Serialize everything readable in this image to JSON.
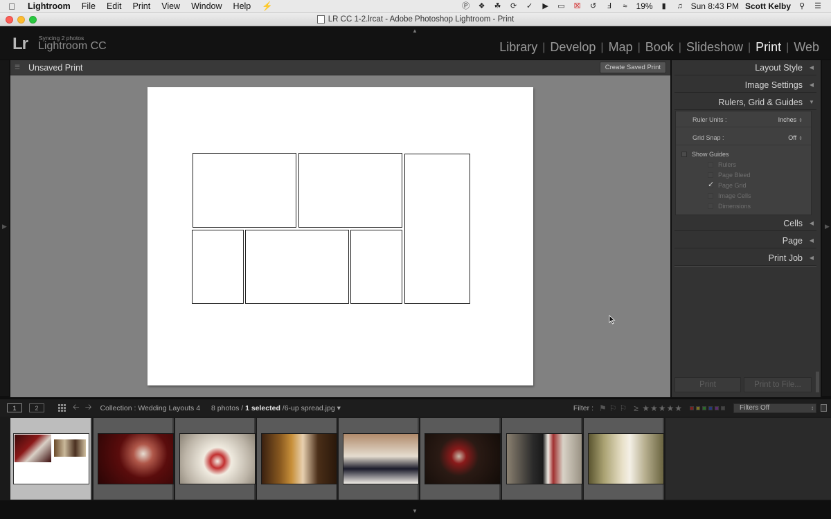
{
  "menubar": {
    "app_name": "Lightroom",
    "items": [
      "File",
      "Edit",
      "Print",
      "View",
      "Window",
      "Help"
    ],
    "battery": "19%",
    "clock": "Sun 8:43 PM",
    "user": "Scott Kelby"
  },
  "window": {
    "title": "LR CC 1-2.lrcat - Adobe Photoshop Lightroom - Print"
  },
  "identity": {
    "sync_status": "Syncing 2 photos",
    "product": "Lightroom CC",
    "logo": "Lr"
  },
  "modules": {
    "items": [
      "Library",
      "Develop",
      "Map",
      "Book",
      "Slideshow",
      "Print",
      "Web"
    ],
    "active": "Print"
  },
  "center": {
    "doc_title": "Unsaved Print",
    "save_button": "Create Saved Print"
  },
  "right_panel": {
    "layout_style": "Layout Style",
    "image_settings": "Image Settings",
    "rulers_grid_guides": "Rulers, Grid & Guides",
    "ruler_units_label": "Ruler Units :",
    "ruler_units_value": "Inches",
    "grid_snap_label": "Grid Snap :",
    "grid_snap_value": "Off",
    "show_guides": "Show Guides",
    "guides": [
      "Rulers",
      "Page Bleed",
      "Page Grid",
      "Image Cells",
      "Dimensions"
    ],
    "page_grid_checked": true,
    "cells": "Cells",
    "page": "Page",
    "print_job": "Print Job",
    "print_button": "Print",
    "print_to_file_button": "Print to File..."
  },
  "filmstrip_toolbar": {
    "screen1": "1",
    "screen2": "2",
    "collection": "Collection : Wedding Layouts 4",
    "photo_count": "8 photos /",
    "selected": "1 selected",
    "filename": "/6-up spread.jpg",
    "filter_label": "Filter :",
    "filters_value": "Filters Off"
  },
  "colors": {
    "active_module": "#efefef",
    "inactive_module": "#9a9a9a",
    "panel_bg": "#333333",
    "canvas_bg": "#818181"
  }
}
